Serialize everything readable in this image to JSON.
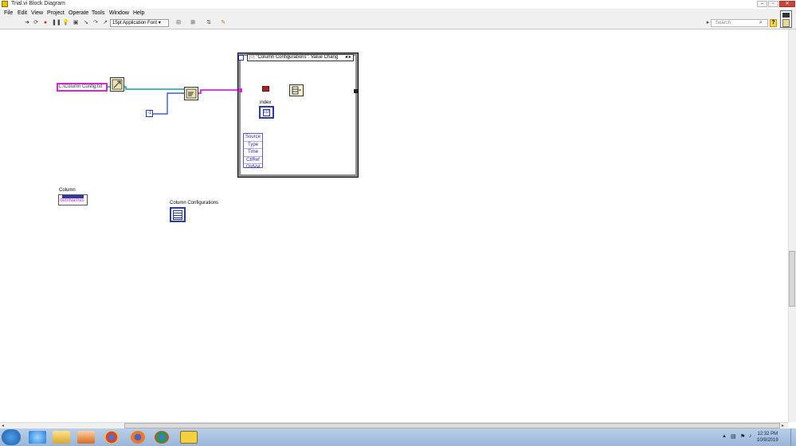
{
  "window": {
    "title": "Trial.vi Block Diagram"
  },
  "menu": [
    "File",
    "Edit",
    "View",
    "Project",
    "Operate",
    "Tools",
    "Window",
    "Help"
  ],
  "toolbar": {
    "font": "15pt Application Font",
    "font_arrow": "▾",
    "search_placeholder": "Search",
    "search_icon": "⌕",
    "help_label": "?"
  },
  "diagram": {
    "path_constant": "L:\\Column Config.txt",
    "numeric_constant": "-1",
    "event_case": "\"Column Configurations\": Value Chang",
    "event_case_arrows": "◂ ▸",
    "event_data_terminals": [
      "Source",
      "Type",
      "Time",
      "CtlRef",
      "OldVal"
    ],
    "index_label": "index",
    "index_terminal": "I32",
    "column_label": "Column",
    "column_property": "ItemNames",
    "column_config_label": "Column Configurations"
  },
  "taskbar": {
    "time": "12:32 PM",
    "date": "10/9/2019"
  },
  "colors": {
    "string_wire": "#d627d6",
    "numeric_wire": "#1f3fae",
    "refnum_wire": "#0aa39a",
    "error_wire": "#8a6c2a",
    "event_border": "#8c8c8c"
  },
  "icons": [
    "app-icon",
    "run-arrow-icon",
    "run-continuous-icon",
    "abort-icon",
    "pause-icon",
    "highlight-icon",
    "retain-wire-icon",
    "step-into-icon",
    "step-over-icon",
    "step-out-icon",
    "align-icon",
    "distribute-icon",
    "reorder-icon",
    "cleanup-icon",
    "search-icon",
    "help-icon",
    "windows-start-icon",
    "ie-icon",
    "explorer-icon",
    "media-icon",
    "chrome-icon",
    "firefox-icon",
    "labview-icon"
  ]
}
